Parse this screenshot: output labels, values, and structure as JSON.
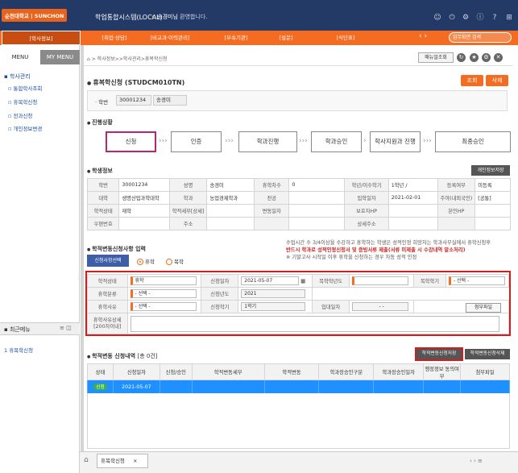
{
  "header": {
    "logo": "순천대학교 | SUNCHON",
    "system_title": "학업통합시스템(LOCAL)",
    "greeting_user": "송경미님",
    "greeting_text": "환영합니다.",
    "icons": [
      "user-icon",
      "logout-icon",
      "settings-icon",
      "info-icon",
      "help-icon",
      "grid-icon"
    ]
  },
  "menubar": {
    "tabs": [
      "[학사정보]",
      "[취업·상담]",
      "[비교과·이력관리]",
      "[부속기관]",
      "[설문]",
      "[식단표]"
    ],
    "search_placeholder": "업무화면 검색"
  },
  "sidebar": {
    "tabs": [
      "MENU",
      "MY MENU"
    ],
    "root": "학사관리",
    "items": [
      "통합학사조회",
      "휴복학신청",
      "전과신청",
      "개인정보변경"
    ],
    "recent_title": "최근메뉴",
    "recent_item": "휴복학신청"
  },
  "breadcrumb": "> 학사정보>>학사관리>휴복학신청",
  "manual_button": "매뉴얼조회",
  "page_title": "휴복학신청 (STUDCM010TN)",
  "buttons": {
    "search": "조회",
    "delete": "삭제",
    "personal_save": "개인정보저장",
    "attach": "첨부파일",
    "apply_save": "학적변동신청저장",
    "apply_delete": "학적변동신청삭제"
  },
  "student": {
    "label": "· 학번",
    "id": "30001234",
    "name": "송경미"
  },
  "progress": {
    "title": "진행상황",
    "steps": [
      "신청",
      "인증",
      "학과진행",
      "학과승인",
      "학사지원과 진행",
      "최종승인"
    ],
    "active_step": "신청"
  },
  "info": {
    "title": "학생정보",
    "rows": [
      [
        "학번",
        "30001234",
        "성명",
        "송경미",
        "휴학차수",
        "0",
        "학년/이수학기",
        "1학년 / ",
        "등록여부",
        "미등록"
      ],
      [
        "대학",
        "생명산업과학대학",
        "학과",
        "농업경제학과",
        "전공",
        "",
        "입학일자",
        "2021-02-01",
        "주야(내외국인)",
        "[공통]"
      ],
      [
        "학적상태",
        "재학",
        "학적세부[상세]",
        "",
        "변동일자",
        "",
        "보호자HP",
        "",
        "본인HP",
        ""
      ],
      [
        "우편번호",
        "",
        "주소",
        "",
        "",
        "",
        "상세주소",
        "",
        "",
        ""
      ]
    ]
  },
  "apply": {
    "title": "학적변동신청사항 입력",
    "note1": "수업시간 수 3/4이상을 수강하고 휴학하는 학생은 성적인정 희망자는 학과사무실에서 휴학신청후",
    "note2": "반드시 학과로 성적인정신청서 및 증빙서류 제출(서류 미제출 시 수강내역 말소처리)",
    "note3": "※ 기말고사 시작일 이후 휴학을 신청하는 경우 자동 성적 인정",
    "selector_label": "신청사항선택",
    "radio_options": [
      "휴학",
      "복학"
    ],
    "radio_selected": "휴학",
    "form": {
      "status_label": "학적상태",
      "status_value": "휴학",
      "apply_date_label": "신청일자",
      "apply_date_value": "2021-05-07",
      "return_year_label": "복학학년도",
      "return_term_label": "복학학기",
      "return_term_value": "- 선택 -",
      "leave_type_label": "휴학분류",
      "leave_type_value": "- 선택 -",
      "apply_year_label": "신청년도",
      "apply_year_value": "2021",
      "leave_reason_label": "휴학사유",
      "leave_reason_value": "- 선택 -",
      "apply_term_label": "신청학기",
      "apply_term_value": "1학기",
      "enlist_date_label": "입대일자",
      "enlist_date_value": "- -",
      "reason_detail_label": "휴학사유상세",
      "reason_detail_count": "[200자이내]"
    }
  },
  "history": {
    "title": "학적변동 신청내역",
    "count_text": "[총 0건]",
    "columns": [
      "상태",
      "신청일자",
      "신청/승인",
      "학적변동세부",
      "학적변동",
      "학과장승인구분",
      "학과장승인일자",
      "행정정보 동의여부",
      "첨부파일"
    ],
    "row": {
      "status": "신청",
      "date": "2021-05-07"
    }
  },
  "bottom": {
    "tab": "휴복학신청",
    "close": "×",
    "nav": "‹ ›  ≡"
  },
  "colors": {
    "navy": "#243a66",
    "orange": "#f36c21",
    "highlight": "#1e90ff",
    "alert": "#d41c1c"
  }
}
